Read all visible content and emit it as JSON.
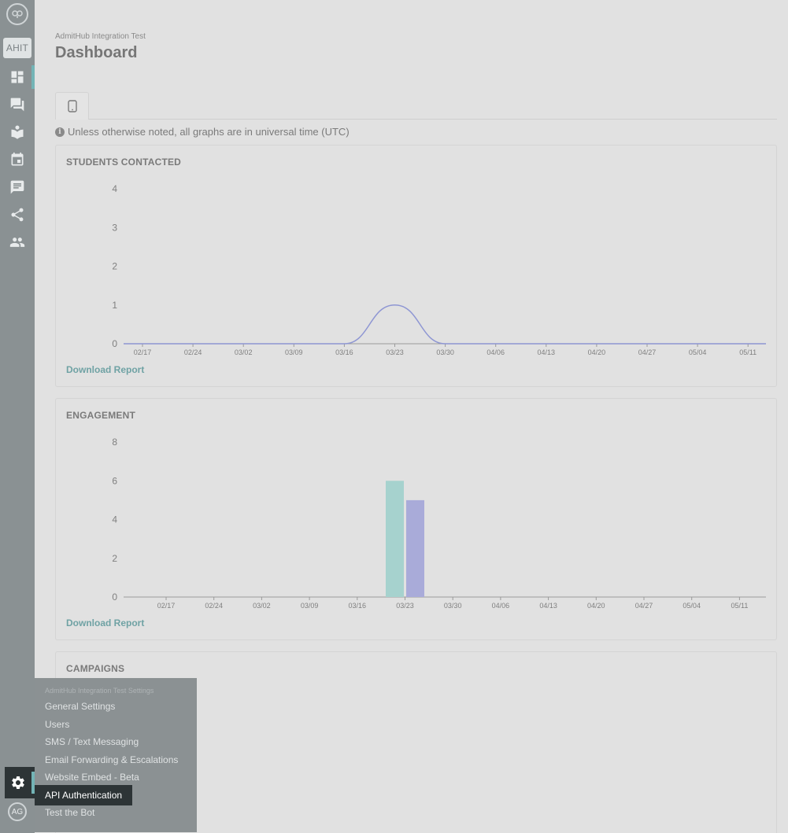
{
  "sidebar": {
    "badge": "AHIT",
    "avatar_initials": "AG",
    "icons": [
      "dashboard-icon",
      "conversations-icon",
      "knowledge-base-icon",
      "calendar-icon",
      "messages-icon",
      "share-icon",
      "people-icon",
      "gear-icon"
    ]
  },
  "header": {
    "org_name": "AdmitHub Integration Test",
    "title": "Dashboard"
  },
  "note": "Unless otherwise noted, all graphs are in universal time (UTC)",
  "panels": {
    "students_contacted": {
      "title": "STUDENTS CONTACTED",
      "download": "Download Report"
    },
    "engagement": {
      "title": "ENGAGEMENT",
      "download": "Download Report"
    },
    "campaigns": {
      "title": "CAMPAIGNS"
    }
  },
  "chart_data": [
    {
      "type": "line",
      "title": "STUDENTS CONTACTED",
      "x": [
        "02/17",
        "02/24",
        "03/02",
        "03/09",
        "03/16",
        "03/23",
        "03/30",
        "04/06",
        "04/13",
        "04/20",
        "04/27",
        "05/04",
        "05/11"
      ],
      "series": [
        {
          "values": [
            0,
            0,
            0,
            0,
            0,
            1,
            0,
            0,
            0,
            0,
            0,
            0,
            0
          ],
          "color": "#8e96d3"
        }
      ],
      "ylim": [
        0,
        4
      ],
      "yticks": [
        "0",
        "1",
        "2",
        "3",
        "4"
      ],
      "grid": false
    },
    {
      "type": "bar",
      "title": "ENGAGEMENT",
      "categories": [
        "02/17",
        "02/24",
        "03/02",
        "03/09",
        "03/16",
        "03/23",
        "03/30",
        "04/06",
        "04/13",
        "04/20",
        "04/27",
        "05/04",
        "05/11"
      ],
      "series": [
        {
          "values": [
            0,
            0,
            0,
            0,
            0,
            6,
            0,
            0,
            0,
            0,
            0,
            0,
            0
          ],
          "color": "#a6d2ce"
        },
        {
          "values": [
            0,
            0,
            0,
            0,
            0,
            5,
            0,
            0,
            0,
            0,
            0,
            0,
            0
          ],
          "color": "#a9abd9"
        }
      ],
      "ylim": [
        0,
        8
      ],
      "yticks": [
        "0",
        "2",
        "4",
        "6",
        "8"
      ],
      "grid": false
    }
  ],
  "settings_menu": {
    "header": "AdmitHub Integration Test Settings",
    "items": [
      {
        "label": "General Settings"
      },
      {
        "label": "Users"
      },
      {
        "label": "SMS / Text Messaging"
      },
      {
        "label": "Email Forwarding & Escalations"
      },
      {
        "label": "Website Embed - Beta"
      },
      {
        "label": "API Authentication",
        "active": true
      },
      {
        "label": "Test the Bot"
      }
    ]
  }
}
